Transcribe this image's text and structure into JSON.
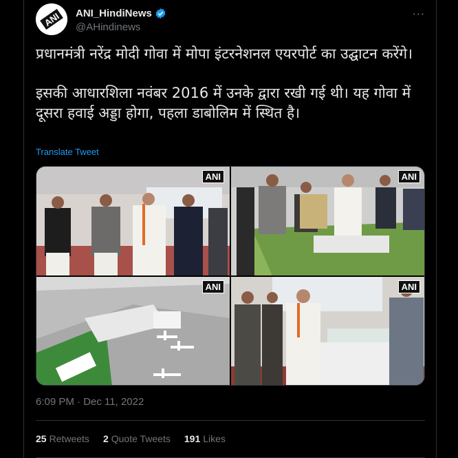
{
  "author": {
    "display_name": "ANI_HindiNews",
    "handle": "@AHindinews",
    "verified": true,
    "avatar_text": "ANI"
  },
  "more_label": "···",
  "tweet": {
    "paragraph1": "प्रधानमंत्री नरेंद्र मोदी गोवा में मोपा इंटरनेशनल एयरपोर्ट का उद्घाटन करेंगे।",
    "paragraph2": "इसकी आधारशिला नवंबर 2016 में उनके द्वारा रखी गई थी। यह गोवा में दूसरा हवाई अड्डा होगा, पहला डाबोलिम में स्थित है।"
  },
  "translate_label": "Translate Tweet",
  "media": {
    "watermark": "ANI",
    "photos": [
      "photo-1",
      "photo-2",
      "photo-3",
      "photo-4"
    ]
  },
  "timestamp": "6:09 PM · Dec 11, 2022",
  "stats": {
    "retweets_count": "25",
    "retweets_label": "Retweets",
    "quotes_count": "2",
    "quotes_label": "Quote Tweets",
    "likes_count": "191",
    "likes_label": "Likes"
  },
  "colors": {
    "background": "#000000",
    "text": "#e7e9ea",
    "secondary": "#71767b",
    "link": "#1d9bf0",
    "divider": "#2f3336"
  }
}
